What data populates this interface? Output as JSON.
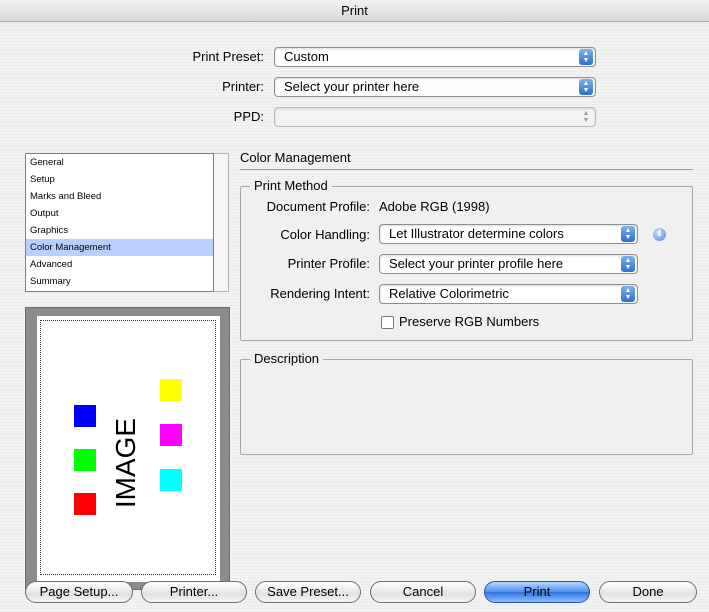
{
  "window": {
    "title": "Print"
  },
  "header": {
    "preset": {
      "label": "Print Preset:",
      "value": "Custom"
    },
    "printer": {
      "label": "Printer:",
      "value": "Select your printer here"
    },
    "ppd": {
      "label": "PPD:",
      "value": ""
    }
  },
  "sidebar": {
    "items": [
      {
        "label": "General"
      },
      {
        "label": "Setup"
      },
      {
        "label": "Marks and Bleed"
      },
      {
        "label": "Output"
      },
      {
        "label": "Graphics"
      },
      {
        "label": "Color Management",
        "selected": true
      },
      {
        "label": "Advanced"
      },
      {
        "label": "Summary"
      }
    ]
  },
  "preview": {
    "image_label": "IMAGE",
    "swatches": [
      {
        "name": "blue",
        "color": "#0000ff"
      },
      {
        "name": "green",
        "color": "#00ff00"
      },
      {
        "name": "red",
        "color": "#ff0000"
      },
      {
        "name": "yellow",
        "color": "#ffff00"
      },
      {
        "name": "magenta",
        "color": "#ff00ff"
      },
      {
        "name": "cyan",
        "color": "#00ffff"
      }
    ]
  },
  "main": {
    "section_title": "Color Management",
    "print_method": {
      "legend": "Print Method",
      "document_profile": {
        "label": "Document Profile:",
        "value": "Adobe RGB (1998)"
      },
      "color_handling": {
        "label": "Color Handling:",
        "value": "Let Illustrator determine colors"
      },
      "printer_profile": {
        "label": "Printer Profile:",
        "value": "Select your printer profile here"
      },
      "rendering_intent": {
        "label": "Rendering Intent:",
        "value": "Relative Colorimetric"
      },
      "preserve_rgb": {
        "label": "Preserve RGB Numbers",
        "checked": false
      }
    },
    "description": {
      "legend": "Description",
      "text": ""
    }
  },
  "buttons": {
    "page_setup": "Page Setup...",
    "printer": "Printer...",
    "save_preset": "Save Preset...",
    "cancel": "Cancel",
    "print": "Print",
    "done": "Done"
  },
  "colors": {
    "accent": "#4d8ff0",
    "selection": "#b7d0ff"
  }
}
